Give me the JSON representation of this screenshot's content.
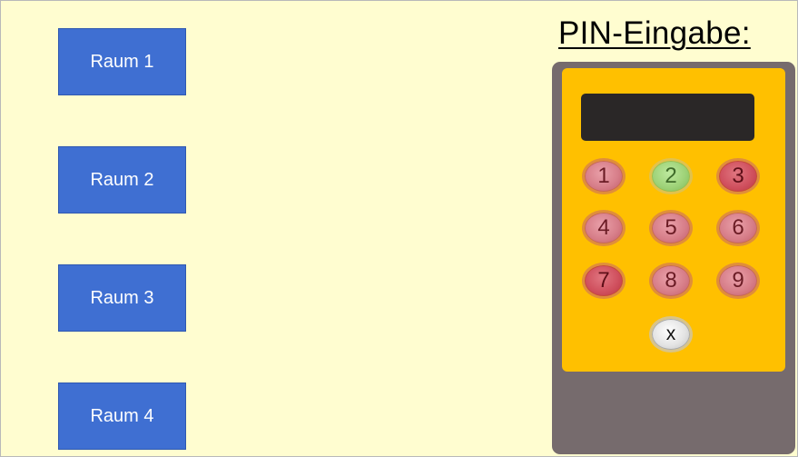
{
  "rooms": [
    {
      "label": "Raum 1"
    },
    {
      "label": "Raum 2"
    },
    {
      "label": "Raum 3"
    },
    {
      "label": "Raum 4"
    }
  ],
  "pin": {
    "title": "PIN-Eingabe:",
    "display_value": "",
    "keys": [
      {
        "label": "1",
        "color": "light-red"
      },
      {
        "label": "2",
        "color": "green"
      },
      {
        "label": "3",
        "color": "dark-red"
      },
      {
        "label": "4",
        "color": "light-red"
      },
      {
        "label": "5",
        "color": "light-red"
      },
      {
        "label": "6",
        "color": "light-red"
      },
      {
        "label": "7",
        "color": "dark-red"
      },
      {
        "label": "8",
        "color": "light-red"
      },
      {
        "label": "9",
        "color": "light-red"
      },
      {
        "label": "x",
        "color": "grey"
      }
    ]
  },
  "colors": {
    "background": "#FFFDD0",
    "room_button": "#3F6FD2",
    "device_body": "#766B6D",
    "keypad_face": "#FFC000",
    "display": "#2A2727"
  }
}
